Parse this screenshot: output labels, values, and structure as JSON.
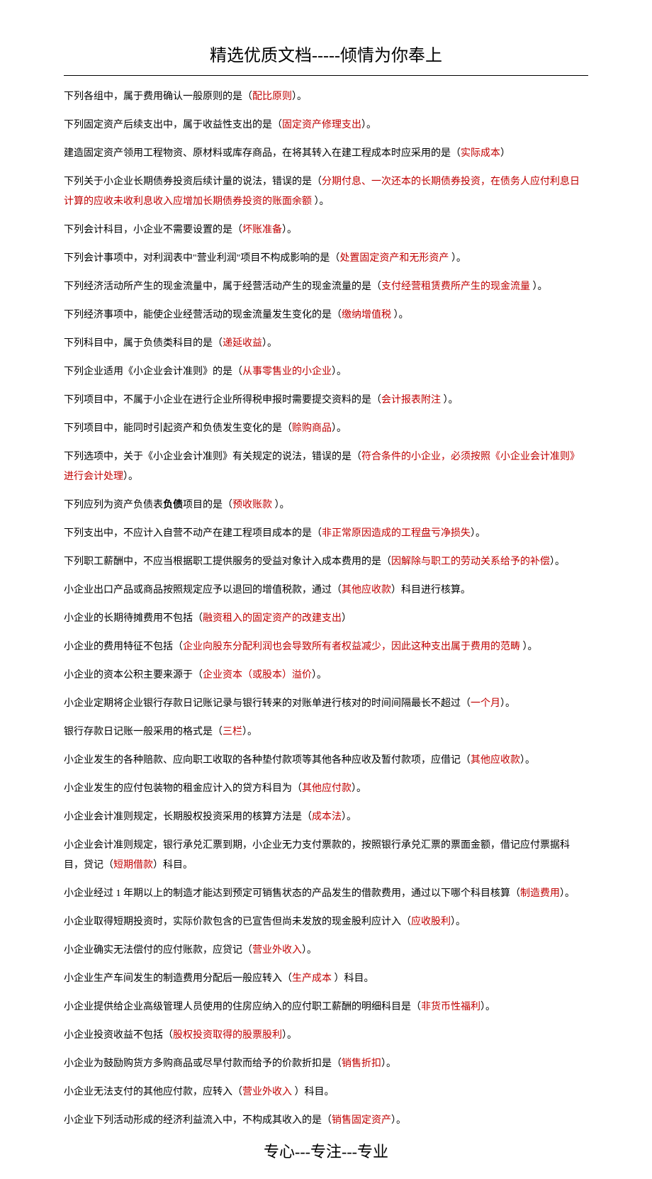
{
  "header": "精选优质文档-----倾情为你奉上",
  "footer": "专心---专注---专业",
  "lines": [
    {
      "segments": [
        {
          "t": "下列各组中，属于费用确认一般原则的是（",
          "c": ""
        },
        {
          "t": "配比原则",
          "c": "red"
        },
        {
          "t": "）。",
          "c": ""
        }
      ]
    },
    {
      "segments": [
        {
          "t": "下列固定资产后续支出中，属于收益性支出的是（",
          "c": ""
        },
        {
          "t": "固定资产修理支出",
          "c": "red"
        },
        {
          "t": "）。",
          "c": ""
        }
      ]
    },
    {
      "segments": [
        {
          "t": "建造固定资产领用工程物资、原材料或库存商品，在将其转入在建工程成本时应采用的是（",
          "c": ""
        },
        {
          "t": "实际成本",
          "c": "red"
        },
        {
          "t": "）",
          "c": ""
        }
      ]
    },
    {
      "segments": [
        {
          "t": "下列关于小企业长期债券投资后续计量的说法，错误的是（",
          "c": ""
        },
        {
          "t": "分期付息、一次还本的长期债券投资，在债务人应付利息日计算的应收未收利息收入应增加长期债券投资的账面余额",
          "c": "red"
        },
        {
          "t": " ）。",
          "c": ""
        }
      ]
    },
    {
      "segments": [
        {
          "t": "下列会计科目，小企业不需要设置的是（",
          "c": ""
        },
        {
          "t": "坏账准备",
          "c": "red"
        },
        {
          "t": "）。",
          "c": ""
        }
      ]
    },
    {
      "segments": [
        {
          "t": "下列会计事项中，对利润表中\"营业利润\"项目不构成影响的是（",
          "c": ""
        },
        {
          "t": "处置固定资产和无形资产",
          "c": "red"
        },
        {
          "t": "  ）。",
          "c": ""
        }
      ]
    },
    {
      "segments": [
        {
          "t": "下列经济活动所产生的现金流量中，属于经营活动产生的现金流量的是（",
          "c": ""
        },
        {
          "t": "支付经营租赁费所产生的现金流量",
          "c": "red"
        },
        {
          "t": " ）。",
          "c": ""
        }
      ]
    },
    {
      "segments": [
        {
          "t": "下列经济事项中，能使企业经营活动的现金流量发生变化的是（",
          "c": ""
        },
        {
          "t": "缴纳增值税",
          "c": "red"
        },
        {
          "t": " ）。",
          "c": ""
        }
      ]
    },
    {
      "segments": [
        {
          "t": "下列科目中，属于负债类科目的是（",
          "c": ""
        },
        {
          "t": "递延收益",
          "c": "red"
        },
        {
          "t": "）。",
          "c": ""
        }
      ]
    },
    {
      "segments": [
        {
          "t": "下列企业适用《小企业会计准则》的是（",
          "c": ""
        },
        {
          "t": "从事零售业的小企业",
          "c": "red"
        },
        {
          "t": "）。",
          "c": ""
        }
      ]
    },
    {
      "segments": [
        {
          "t": "下列项目中，不属于小企业在进行企业所得税申报时需要提交资料的是（",
          "c": ""
        },
        {
          "t": "会计报表附注",
          "c": "red"
        },
        {
          "t": "  ）。",
          "c": ""
        }
      ]
    },
    {
      "segments": [
        {
          "t": "下列项目中，能同时引起资产和负债发生变化的是（",
          "c": ""
        },
        {
          "t": "赊购商品",
          "c": "red"
        },
        {
          "t": "）。",
          "c": ""
        }
      ]
    },
    {
      "segments": [
        {
          "t": "下列选项中，关于《小企业会计准则》有关规定的说法，错误的是（",
          "c": ""
        },
        {
          "t": "符合条件的小企业，必须按照《小企业会计准则》进行会计处理",
          "c": "red"
        },
        {
          "t": "）。",
          "c": ""
        }
      ]
    },
    {
      "segments": [
        {
          "t": "下列应列为资产负债表",
          "c": ""
        },
        {
          "t": "负债",
          "c": "bold"
        },
        {
          "t": "项目的是（",
          "c": ""
        },
        {
          "t": "预收账款",
          "c": "red"
        },
        {
          "t": " ）。",
          "c": ""
        }
      ]
    },
    {
      "segments": [
        {
          "t": "下列支出中，不应计入自营不动产在建工程项目成本的是（",
          "c": ""
        },
        {
          "t": "非正常原因造成的工程盘亏净损失",
          "c": "red"
        },
        {
          "t": "）。",
          "c": ""
        }
      ]
    },
    {
      "segments": [
        {
          "t": "下列职工薪酬中，不应当根据职工提供服务的受益对象计入成本费用的是（",
          "c": ""
        },
        {
          "t": "因解除与职工的劳动关系给予的补偿",
          "c": "red"
        },
        {
          "t": "）。",
          "c": ""
        }
      ]
    },
    {
      "segments": [
        {
          "t": "小企业出口产品或商品按照规定应予以退回的增值税款，通过（",
          "c": ""
        },
        {
          "t": "其他应收款",
          "c": "red"
        },
        {
          "t": "）科目进行核算。",
          "c": ""
        }
      ]
    },
    {
      "segments": [
        {
          "t": "小企业的长期待摊费用不包括（",
          "c": ""
        },
        {
          "t": "融资租入的固定资产的改建支出",
          "c": "red"
        },
        {
          "t": "）",
          "c": ""
        }
      ]
    },
    {
      "segments": [
        {
          "t": "小企业的费用特征不包括（",
          "c": ""
        },
        {
          "t": "企业向股东分配利润也会导致所有者权益减少，因此这种支出属于费用的范畴",
          "c": "red"
        },
        {
          "t": " ）。",
          "c": ""
        }
      ]
    },
    {
      "segments": [
        {
          "t": "小企业的资本公积主要来源于（",
          "c": ""
        },
        {
          "t": "企业资本（或股本）溢价",
          "c": "red"
        },
        {
          "t": "）。",
          "c": ""
        }
      ]
    },
    {
      "segments": [
        {
          "t": "小企业定期将企业银行存款日记账记录与银行转来的对账单进行核对的时间间隔最长不超过（",
          "c": ""
        },
        {
          "t": "一个月",
          "c": "red"
        },
        {
          "t": "）。",
          "c": ""
        }
      ]
    },
    {
      "segments": [
        {
          "t": "银行存款日记账一般采用的格式是（",
          "c": ""
        },
        {
          "t": "三栏",
          "c": "red"
        },
        {
          "t": "）。",
          "c": ""
        }
      ]
    },
    {
      "segments": [
        {
          "t": "小企业发生的各种赔款、应向职工收取的各种垫付款项等其他各种应收及暂付款项，应借记（",
          "c": ""
        },
        {
          "t": "其他应收款",
          "c": "red"
        },
        {
          "t": "）。",
          "c": ""
        }
      ]
    },
    {
      "segments": [
        {
          "t": "小企业发生的应付包装物的租金应计入的贷方科目为（",
          "c": ""
        },
        {
          "t": "其他应付款",
          "c": "red"
        },
        {
          "t": "）。",
          "c": ""
        }
      ]
    },
    {
      "segments": [
        {
          "t": "小企业会计准则规定，长期股权投资采用的核算方法是（",
          "c": ""
        },
        {
          "t": "成本法",
          "c": "red"
        },
        {
          "t": "）。",
          "c": ""
        }
      ]
    },
    {
      "segments": [
        {
          "t": "小企业会计准则规定，银行承兑汇票到期，小企业无力支付票款的，按照银行承兑汇票的票面金额，借记应付票据科目，贷记（",
          "c": ""
        },
        {
          "t": "短期借款",
          "c": "red"
        },
        {
          "t": "）科目。",
          "c": ""
        }
      ]
    },
    {
      "segments": [
        {
          "t": "小企业经过 1 年期以上的制造才能达到预定可销售状态的产品发生的借款费用，通过以下哪个科目核算（",
          "c": ""
        },
        {
          "t": "制造费用",
          "c": "red"
        },
        {
          "t": "）。",
          "c": ""
        }
      ]
    },
    {
      "segments": [
        {
          "t": "小企业取得短期投资时，实际价款包含的已宣告但尚未发放的现金股利应计入（",
          "c": ""
        },
        {
          "t": "应收股利",
          "c": "red"
        },
        {
          "t": "）。",
          "c": ""
        }
      ]
    },
    {
      "segments": [
        {
          "t": "小企业确实无法偿付的应付账款，应贷记（",
          "c": ""
        },
        {
          "t": "营业外收入",
          "c": "red"
        },
        {
          "t": "）。",
          "c": ""
        }
      ]
    },
    {
      "segments": [
        {
          "t": "小企业生产车间发生的制造费用分配后一般应转入（",
          "c": ""
        },
        {
          "t": "生产成本",
          "c": "red"
        },
        {
          "t": " ）科目。",
          "c": ""
        }
      ]
    },
    {
      "segments": [
        {
          "t": "小企业提供给企业高级管理人员使用的住房应纳入的应付职工薪酬的明细科目是（",
          "c": ""
        },
        {
          "t": "非货币性福利",
          "c": "red"
        },
        {
          "t": "）。",
          "c": ""
        }
      ]
    },
    {
      "segments": [
        {
          "t": "小企业投资收益不包括（",
          "c": ""
        },
        {
          "t": "股权投资取得的股票股利",
          "c": "red"
        },
        {
          "t": "）。",
          "c": ""
        }
      ]
    },
    {
      "segments": [
        {
          "t": "小企业为鼓励购货方多购商品或尽早付款而给予的价款折扣是（",
          "c": ""
        },
        {
          "t": "销售折扣",
          "c": "red"
        },
        {
          "t": "）。",
          "c": ""
        }
      ]
    },
    {
      "segments": [
        {
          "t": "小企业无法支付的其他应付款，应转入（",
          "c": ""
        },
        {
          "t": "营业外收入",
          "c": "red"
        },
        {
          "t": " ）科目。",
          "c": ""
        }
      ]
    },
    {
      "segments": [
        {
          "t": "小企业下列活动形成的经济利益流入中，不构成其收入的是（",
          "c": ""
        },
        {
          "t": "销售固定资产",
          "c": "red"
        },
        {
          "t": "）。",
          "c": ""
        }
      ]
    }
  ]
}
